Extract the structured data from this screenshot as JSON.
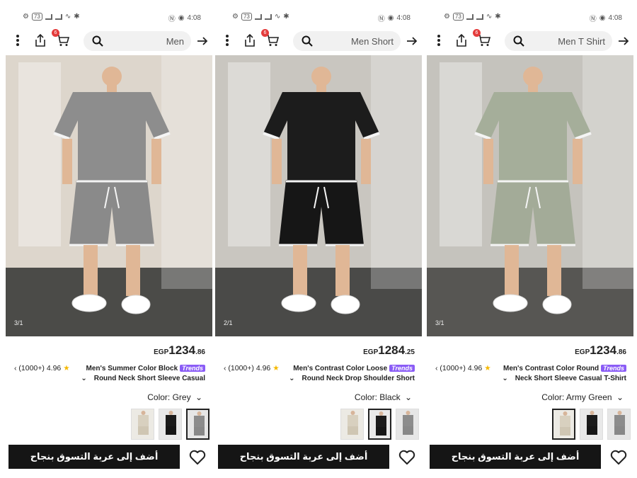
{
  "status": {
    "time": "4:08",
    "battery": "73"
  },
  "panels": [
    {
      "search_query": "Men",
      "cart_count": "6",
      "photo_page": "3/1",
      "price": {
        "currency": "EGP",
        "integer": "1234",
        "decimal": ".86"
      },
      "rating": {
        "count": "(1000+)",
        "score": "4.96"
      },
      "title_line1": "Men's Summer Color Block",
      "title_line2": "Round Neck Short Sleeve Casual",
      "trends_label": "Trends",
      "color_label": "Color: Grey",
      "add_to_cart": "أضف إلى عربة التسوق بنجاح",
      "shirt_color": "#8d8d8d",
      "shorts_color": "#8a8a8a"
    },
    {
      "search_query": "Men Short",
      "cart_count": "6",
      "photo_page": "2/1",
      "price": {
        "currency": "EGP",
        "integer": "1284",
        "decimal": ".25"
      },
      "rating": {
        "count": "(1000+)",
        "score": "4.96"
      },
      "title_line1": "Men's Contrast Color Loose",
      "title_line2": "Round Neck Drop Shoulder Short",
      "trends_label": "Trends",
      "color_label": "Color: Black",
      "add_to_cart": "أضف إلى عربة التسوق بنجاح",
      "shirt_color": "#1c1c1c",
      "shorts_color": "#161616"
    },
    {
      "search_query": "Men T Shirt",
      "cart_count": "6",
      "photo_page": "3/1",
      "price": {
        "currency": "EGP",
        "integer": "1234",
        "decimal": ".86"
      },
      "rating": {
        "count": "(1000+)",
        "score": "4.96"
      },
      "title_line1": "Men's Contrast Color Round",
      "title_line2": "Neck Short Sleeve Casual T-Shirt",
      "trends_label": "Trends",
      "color_label": "Color: Army Green",
      "add_to_cart": "أضف إلى عربة التسوق بنجاح",
      "shirt_color": "#a5ae9a",
      "shorts_color": "#a3ab98"
    }
  ],
  "icons": [
    "more-vert-icon",
    "share-icon",
    "cart-icon",
    "search-icon",
    "arrow-right-icon",
    "chevron-left-icon",
    "chevron-down-icon",
    "star-icon",
    "heart-icon"
  ]
}
